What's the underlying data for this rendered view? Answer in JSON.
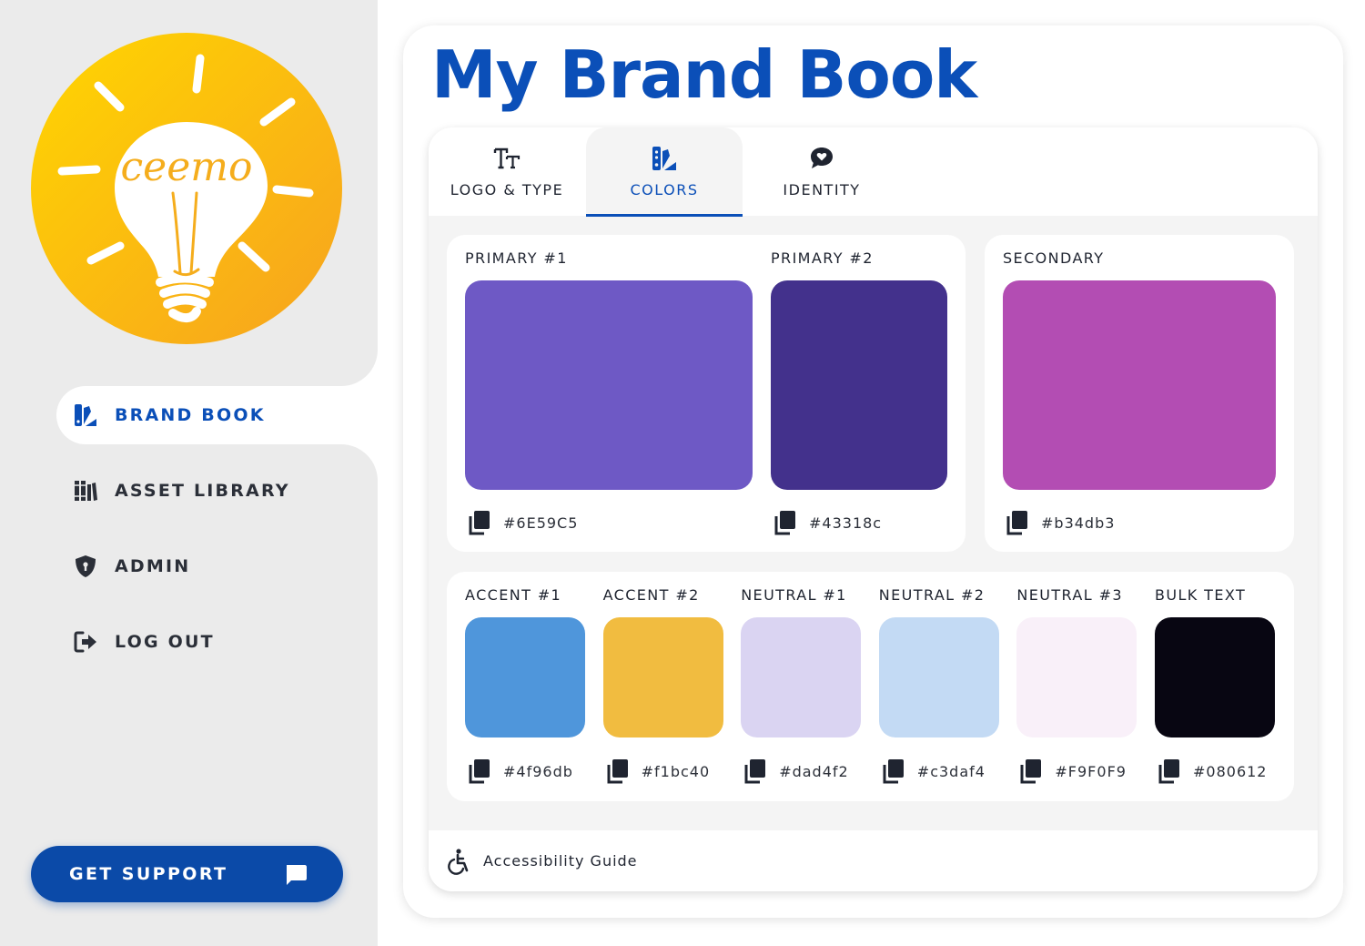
{
  "logo": {
    "text": "ceemo",
    "icon": "lightbulb-icon",
    "gradient": [
      "#ffd600",
      "#f7a51f"
    ]
  },
  "sidebar": {
    "items": [
      {
        "label": "BRAND BOOK",
        "icon": "brand-book-icon",
        "active": true
      },
      {
        "label": "ASSET LIBRARY",
        "icon": "library-icon",
        "active": false
      },
      {
        "label": "ADMIN",
        "icon": "shield-icon",
        "active": false
      },
      {
        "label": "LOG OUT",
        "icon": "logout-icon",
        "active": false
      }
    ],
    "support_label": "GET SUPPORT",
    "support_icon": "chat-icon"
  },
  "page": {
    "title": "My Brand Book"
  },
  "tabs": [
    {
      "label": "LOGO & TYPE",
      "icon": "text-size-icon",
      "active": false
    },
    {
      "label": "COLORS",
      "icon": "palette-icon",
      "active": true
    },
    {
      "label": "IDENTITY",
      "icon": "speech-heart-icon",
      "active": false
    }
  ],
  "colors": {
    "primary": [
      {
        "label": "PRIMARY #1",
        "hex": "#6E59C5"
      },
      {
        "label": "PRIMARY #2",
        "hex": "#43318c"
      }
    ],
    "secondary": {
      "label": "SECONDARY",
      "hex": "#b34db3"
    },
    "others": [
      {
        "label": "ACCENT #1",
        "hex": "#4f96db"
      },
      {
        "label": "ACCENT #2",
        "hex": "#f1bc40"
      },
      {
        "label": "NEUTRAL #1",
        "hex": "#dad4f2"
      },
      {
        "label": "NEUTRAL #2",
        "hex": "#c3daf4"
      },
      {
        "label": "NEUTRAL #3",
        "hex": "#F9F0F9"
      },
      {
        "label": "BULK TEXT",
        "hex": "#080612"
      }
    ]
  },
  "footer": {
    "label": "Accessibility Guide",
    "icon": "accessibility-icon"
  },
  "theme": {
    "accent": "#0b4fb8",
    "button": "#0b4aa8"
  }
}
